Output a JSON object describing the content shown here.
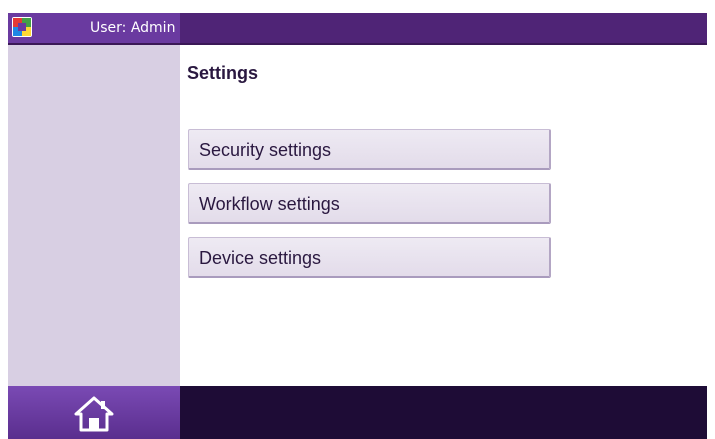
{
  "header": {
    "user_label": "User: Admin",
    "logo_icon": "color-logo-icon"
  },
  "main": {
    "title": "Settings",
    "menu": [
      {
        "label": "Security settings"
      },
      {
        "label": "Workflow settings"
      },
      {
        "label": "Device settings"
      }
    ]
  },
  "footer": {
    "home_icon": "home-icon"
  },
  "colors": {
    "topbar": "#4f2476",
    "sidebar": "#d8cfe3",
    "bottombar": "#1e0c36",
    "home_button": "#6a3aa0",
    "button_face": "#e8e2ef",
    "text": "#2a1840"
  }
}
